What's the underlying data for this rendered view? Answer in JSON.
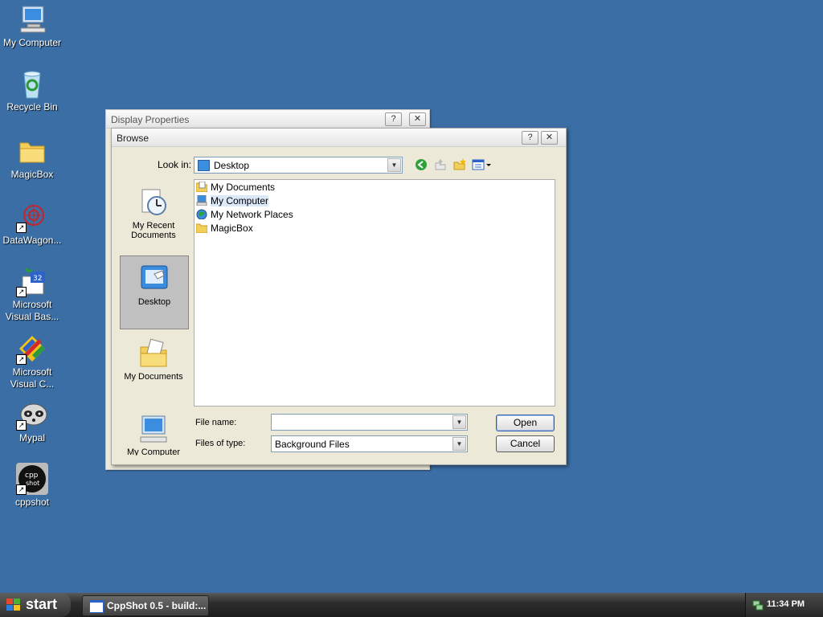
{
  "desktop": {
    "icons": [
      {
        "label": "My Computer"
      },
      {
        "label": "Recycle Bin"
      },
      {
        "label": "MagicBox"
      },
      {
        "label": "DataWagon..."
      },
      {
        "label": "Microsoft\nVisual Bas..."
      },
      {
        "label": "Microsoft\nVisual C..."
      },
      {
        "label": "Mypal"
      },
      {
        "label": "cppshot"
      }
    ]
  },
  "display_properties": {
    "title": "Display Properties",
    "help_label": "?",
    "close_label": "✕"
  },
  "browse": {
    "title": "Browse",
    "help_label": "?",
    "close_label": "✕",
    "look_in_label": "Look in:",
    "look_in_value": "Desktop",
    "places": [
      {
        "label": "My Recent\nDocuments"
      },
      {
        "label": "Desktop"
      },
      {
        "label": "My Documents"
      },
      {
        "label": "My Computer"
      }
    ],
    "files": [
      {
        "label": "My Documents"
      },
      {
        "label": "My Computer"
      },
      {
        "label": "My Network Places"
      },
      {
        "label": "MagicBox"
      }
    ],
    "file_name_label": "File name:",
    "file_name_value": "",
    "files_of_type_label": "Files of type:",
    "files_of_type_value": "Background Files",
    "open_label": "Open",
    "cancel_label": "Cancel"
  },
  "taskbar": {
    "start_label": "start",
    "task_label": "CppShot 0.5 - build:...",
    "clock": "11:34 PM"
  }
}
